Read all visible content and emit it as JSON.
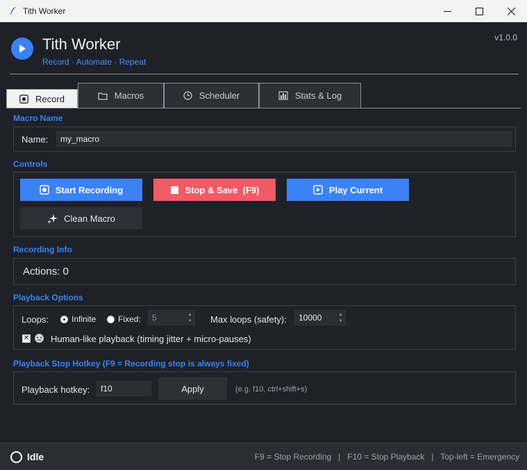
{
  "window": {
    "title": "Tith Worker"
  },
  "header": {
    "title": "Tith Worker",
    "subtitle": "Record · Automate · Repeat",
    "version": "v1.0.0",
    "accent_color": "#3b82f6"
  },
  "tabs": [
    {
      "label": "Record",
      "icon": "record-icon",
      "active": true
    },
    {
      "label": "Macros",
      "icon": "folder-icon",
      "active": false
    },
    {
      "label": "Scheduler",
      "icon": "clock-icon",
      "active": false
    },
    {
      "label": "Stats & Log",
      "icon": "chart-icon",
      "active": false
    }
  ],
  "macro_name": {
    "section_label": "Macro Name",
    "field_label": "Name:",
    "value": "my_macro"
  },
  "controls": {
    "section_label": "Controls",
    "start_recording": "Start Recording",
    "stop_save": "Stop & Save  (F9)",
    "play_current": "Play Current",
    "clean_macro": "Clean Macro"
  },
  "recording_info": {
    "section_label": "Recording Info",
    "actions": "Actions: 0"
  },
  "playback_options": {
    "section_label": "Playback Options",
    "loops_label": "Loops:",
    "infinite_label": "Infinite",
    "fixed_label": "Fixed:",
    "selected": "infinite",
    "fixed_value": "5",
    "max_loops_label": "Max loops (safety):",
    "max_loops_value": "10000",
    "human_like_checked": true,
    "human_like_label": "Human-like playback  (timing jitter + micro-pauses)"
  },
  "hotkey": {
    "section_label": "Playback Stop Hotkey  (F9 = Recording stop is always fixed)",
    "field_label": "Playback hotkey:",
    "value": "f10",
    "apply": "Apply",
    "hint": "(e.g. f10, ctrl+shift+s)"
  },
  "status": {
    "text": "Idle",
    "shortcuts": "F9 = Stop Recording   |   F10 = Stop Playback   |   Top-left = Emergency"
  }
}
